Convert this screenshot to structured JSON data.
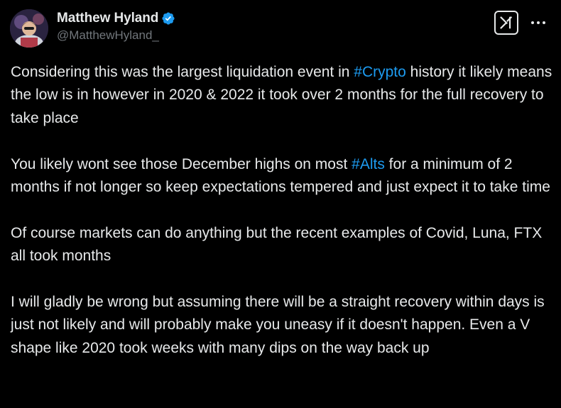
{
  "author": {
    "display_name": "Matthew Hyland",
    "handle": "@MatthewHyland_",
    "verified": true,
    "verified_color": "#1d9bf0"
  },
  "icons": {
    "grok": "grok-icon",
    "more": "more-dots-icon",
    "verified": "verified-badge-icon"
  },
  "tweet": {
    "paragraphs": [
      {
        "before": "Considering this was the largest liquidation event in ",
        "hashtag": "#Crypto",
        "after": " history it likely means the low is in however in 2020 & 2022 it took over 2 months for the full recovery to take place"
      },
      {
        "before": "You likely wont see those December highs on most ",
        "hashtag": "#Alts",
        "after": " for a minimum of 2 months if not longer so keep expectations tempered and just expect it to take time"
      },
      {
        "text": "Of course markets can do anything but the recent examples of Covid, Luna, FTX all took months"
      },
      {
        "text": "I will gladly be wrong but assuming there will be a straight recovery within days is just not likely and will probably make you uneasy if it doesn't happen. Even a V shape like 2020 took weeks with many dips on the way back up"
      }
    ]
  },
  "colors": {
    "background": "#000000",
    "text": "#e7e9ea",
    "secondary_text": "#71767b",
    "link": "#1d9bf0"
  }
}
